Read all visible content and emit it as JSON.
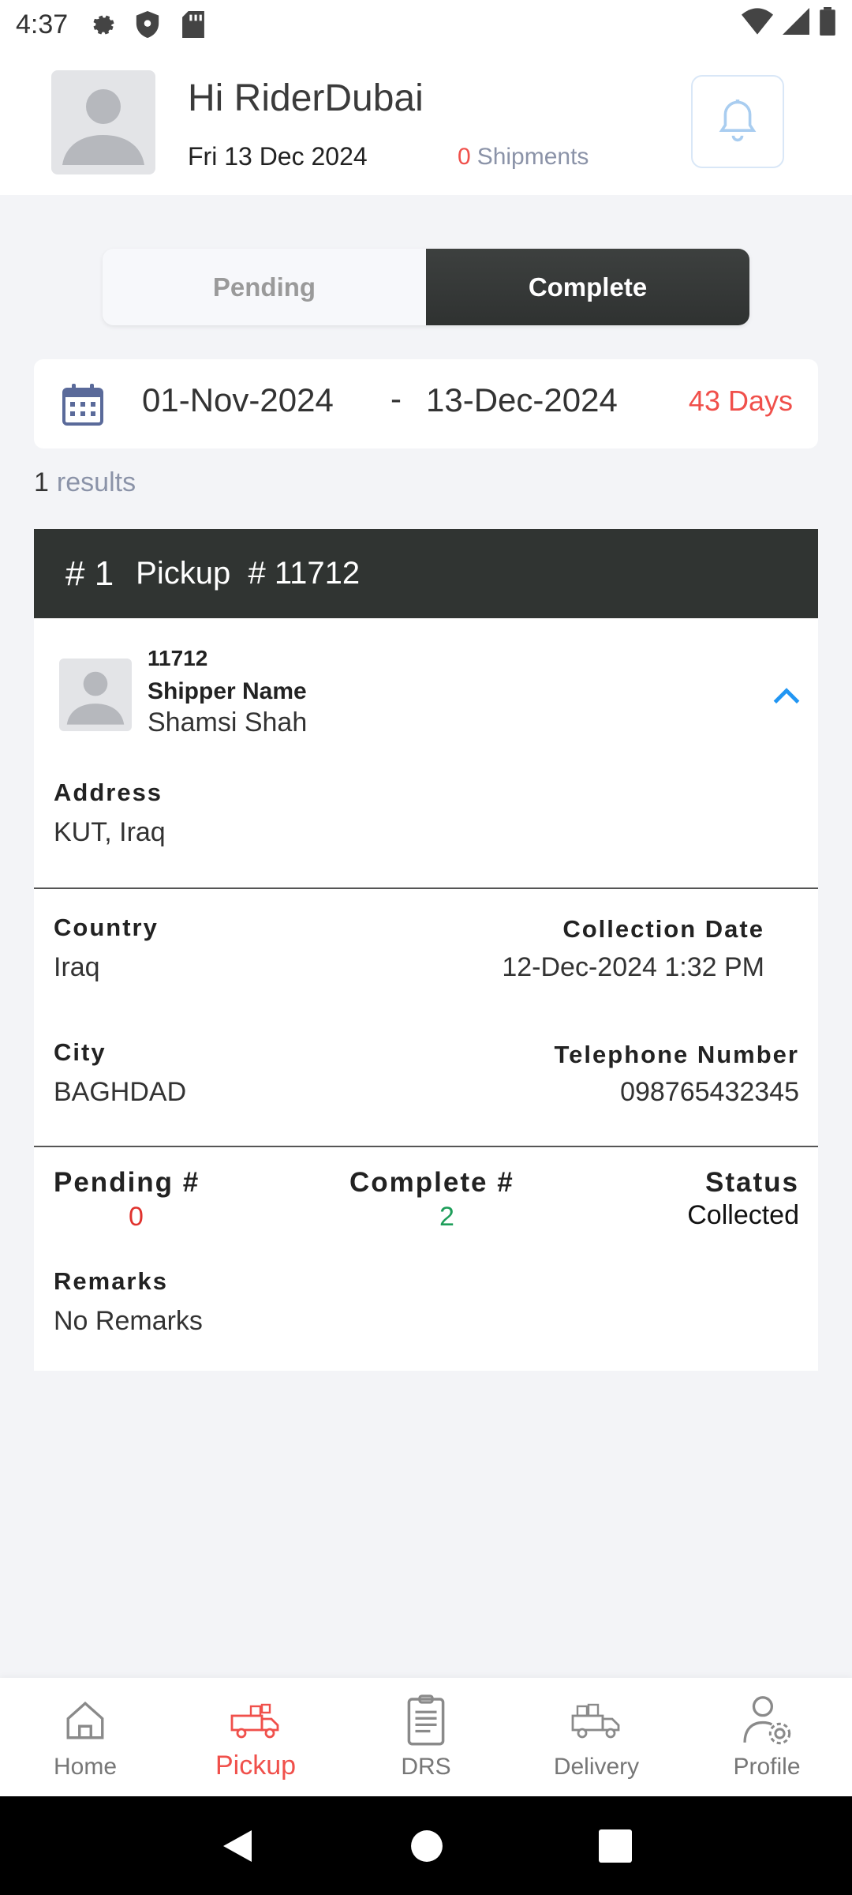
{
  "status_bar": {
    "time": "4:37"
  },
  "header": {
    "greeting": "Hi RiderDubai",
    "date": "Fri 13 Dec 2024",
    "shipments_count": "0",
    "shipments_label": "Shipments"
  },
  "tabs": [
    {
      "label": "Pending",
      "active": false
    },
    {
      "label": "Complete",
      "active": true
    }
  ],
  "date_range": {
    "from": "01-Nov-2024",
    "separator": "-",
    "to": "13-Dec-2024",
    "days": "43 Days"
  },
  "results": {
    "count": "1",
    "label": "results"
  },
  "pickup_card": {
    "index": "# 1",
    "title": "Pickup  # 11712",
    "shipper_id": "11712",
    "shipper_label": "Shipper Name",
    "shipper_name": "Shamsi Shah",
    "address_label": "Address",
    "address": "KUT, Iraq",
    "country_label": "Country",
    "country": "Iraq",
    "collection_date_label": "Collection Date",
    "collection_date": "12-Dec-2024 1:32 PM",
    "city_label": "City",
    "city": "BAGHDAD",
    "telephone_label": "Telephone Number",
    "telephone": "098765432345",
    "pending_label": "Pending #",
    "pending_value": "0",
    "complete_label": "Complete #",
    "complete_value": "2",
    "status_label": "Status",
    "status_value": "Collected",
    "remarks_label": "Remarks",
    "remarks": "No Remarks"
  },
  "bottom_nav": [
    {
      "label": "Home",
      "icon": "home-icon",
      "active": false
    },
    {
      "label": "Pickup",
      "icon": "pickup-truck-icon",
      "active": true
    },
    {
      "label": "DRS",
      "icon": "document-icon",
      "active": false
    },
    {
      "label": "Delivery",
      "icon": "delivery-truck-icon",
      "active": false
    },
    {
      "label": "Profile",
      "icon": "profile-settings-icon",
      "active": false
    }
  ],
  "colors": {
    "accent": "#f0504b",
    "dark": "#303432",
    "green": "#1e9e5a",
    "blue": "#2196f3"
  }
}
